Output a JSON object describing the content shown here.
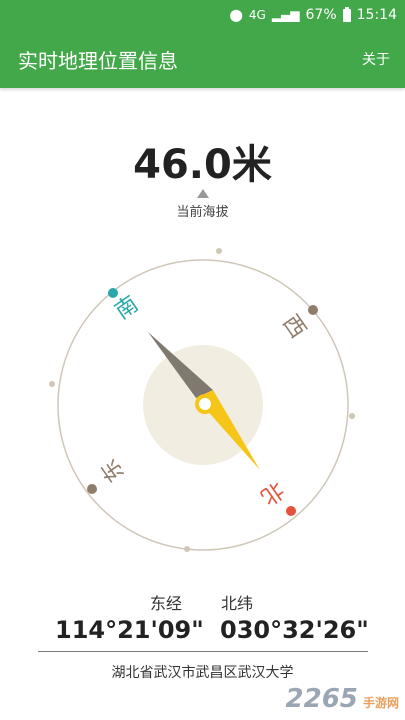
{
  "status_bar": {
    "network": "4G",
    "battery": "67%",
    "time": "15:14"
  },
  "app_bar": {
    "title": "实时地理位置信息",
    "about_label": "关于"
  },
  "altitude": {
    "value": "46.0米",
    "label": "当前海拔"
  },
  "compass": {
    "directions": {
      "south": "南",
      "west": "西",
      "north": "北",
      "east": "东"
    },
    "colors": {
      "south": "#2aa7a8",
      "north": "#e5533c",
      "marker": "#8f7c6a",
      "ring": "#cfc6b8",
      "needle_dark": "#7f7970",
      "needle_yellow": "#f5c518",
      "center": "#f2ede1"
    }
  },
  "coordinates": {
    "longitude_label": "东经",
    "longitude_value": "114°21'09\"",
    "latitude_label": "北纬",
    "latitude_value": "030°32'26\""
  },
  "address": "湖北省武汉市武昌区武汉大学",
  "watermark": {
    "number": "2265",
    "site": "手游网"
  }
}
